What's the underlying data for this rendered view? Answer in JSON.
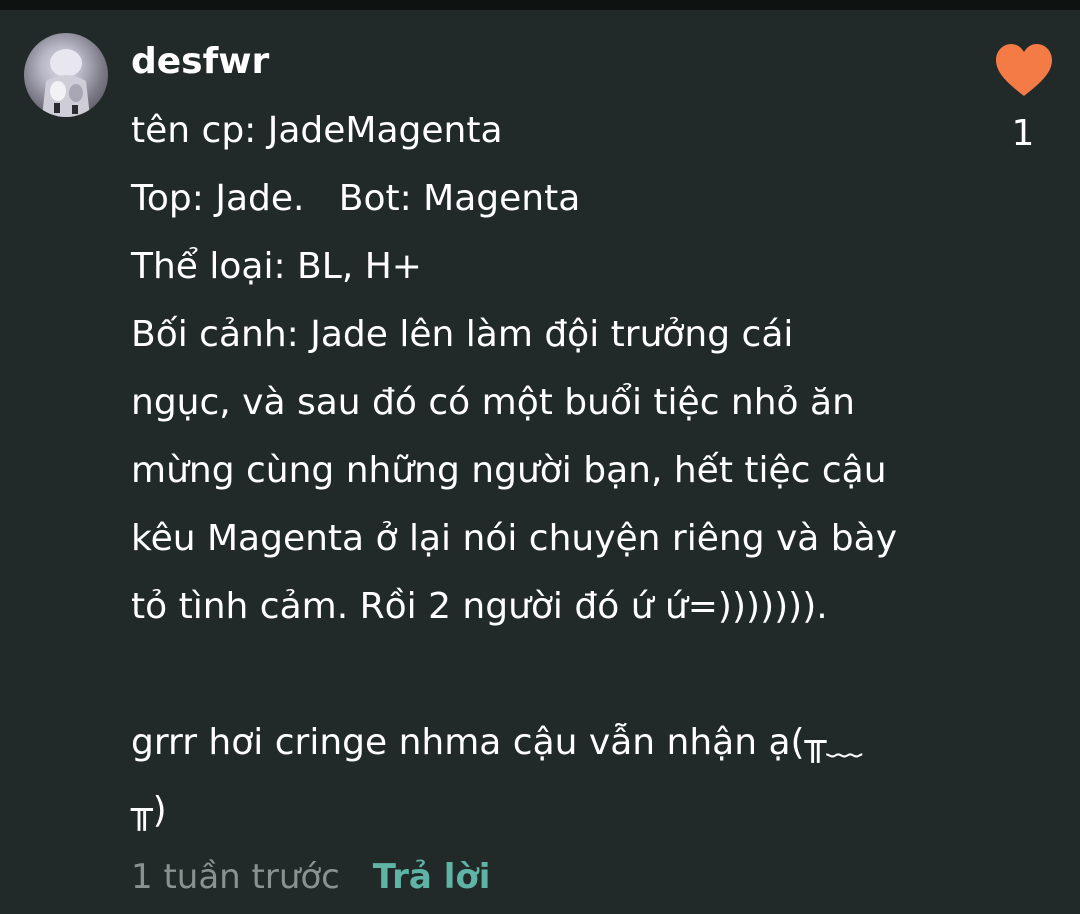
{
  "comment": {
    "username": "desfwr",
    "lines": [
      "tên cp: JadeMagenta",
      "Top: Jade.   Bot: Magenta",
      "Thể loại: BL, H+",
      "Bối cảnh: Jade lên làm đội trưởng cái",
      "ngục, và sau đó có một buổi tiệc nhỏ ăn",
      "mừng cùng những người bạn, hết tiệc cậu",
      "kêu Magenta ở lại nói chuyện riêng và bày",
      "tỏ tình cảm. Rồi 2 người đó ứ ứ=))))))).",
      "",
      "grrr hơi cringe nhma cậu vẫn nhận ạ(╥﹏",
      "╥)"
    ],
    "timestamp": "1 tuần trước",
    "reply_label": "Trả lời",
    "like_count": "1",
    "like_icon": "heart-icon",
    "like_color": "#f47b45"
  }
}
